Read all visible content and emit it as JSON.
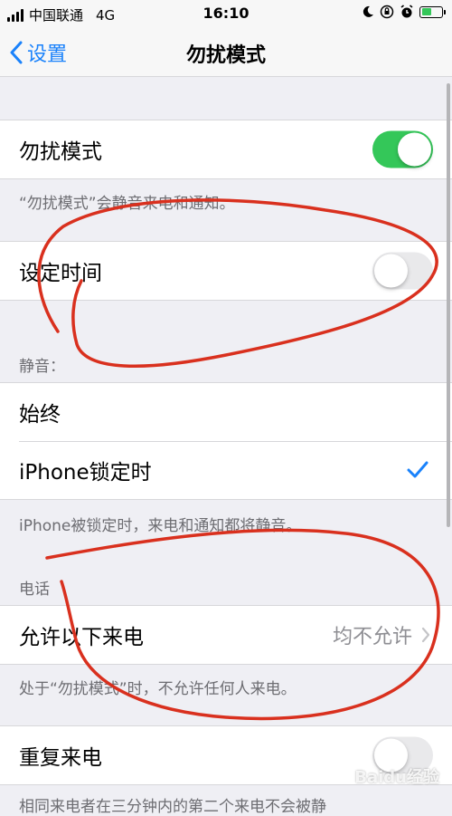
{
  "status_bar": {
    "carrier": "中国联通",
    "network": "4G",
    "time": "16:10",
    "battery_color": "#34c759"
  },
  "nav": {
    "back_label": "设置",
    "title": "勿扰模式",
    "accent_color": "#1a82fb"
  },
  "dnd": {
    "label": "勿扰模式",
    "enabled": true,
    "footer": "“勿扰模式”会静音来电和通知。"
  },
  "scheduled": {
    "label": "设定时间",
    "enabled": false
  },
  "silence": {
    "header": "静音：",
    "options": [
      {
        "label": "始终",
        "selected": false
      },
      {
        "label": "iPhone锁定时",
        "selected": true
      }
    ],
    "footer": "iPhone被锁定时，来电和通知都将静音。"
  },
  "phone": {
    "header": "电话",
    "allow_calls_label": "允许以下来电",
    "allow_calls_value": "均不允许",
    "footer": "处于“勿扰模式”时，不允许任何人来电。",
    "repeated_calls_label": "重复来电",
    "repeated_calls_enabled": false,
    "repeated_calls_footer": "相同来电者在三分钟内的第二个来电不会被静"
  },
  "watermark": "Baidu经验",
  "annotation_color": "#d9301e"
}
